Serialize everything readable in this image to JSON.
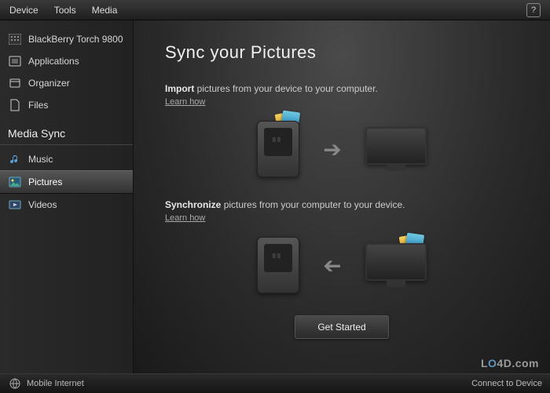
{
  "menu": {
    "device": "Device",
    "tools": "Tools",
    "media": "Media",
    "help": "?"
  },
  "sidebar": {
    "items": [
      {
        "label": "BlackBerry Torch 9800"
      },
      {
        "label": "Applications"
      },
      {
        "label": "Organizer"
      },
      {
        "label": "Files"
      }
    ],
    "section": "Media Sync",
    "media": [
      {
        "label": "Music"
      },
      {
        "label": "Pictures"
      },
      {
        "label": "Videos"
      }
    ]
  },
  "main": {
    "title": "Sync your Pictures",
    "import": {
      "bold": "Import",
      "rest": " pictures from your device to your computer.",
      "learn": "Learn how"
    },
    "sync": {
      "bold": "Synchronize",
      "rest": " pictures from your computer to your device.",
      "learn": "Learn how"
    },
    "get_started": "Get Started"
  },
  "footer": {
    "mobile": "Mobile Internet",
    "connect": "Connect to Device"
  },
  "watermark": {
    "a": "L",
    "b": "O",
    "c": "4D.com"
  }
}
